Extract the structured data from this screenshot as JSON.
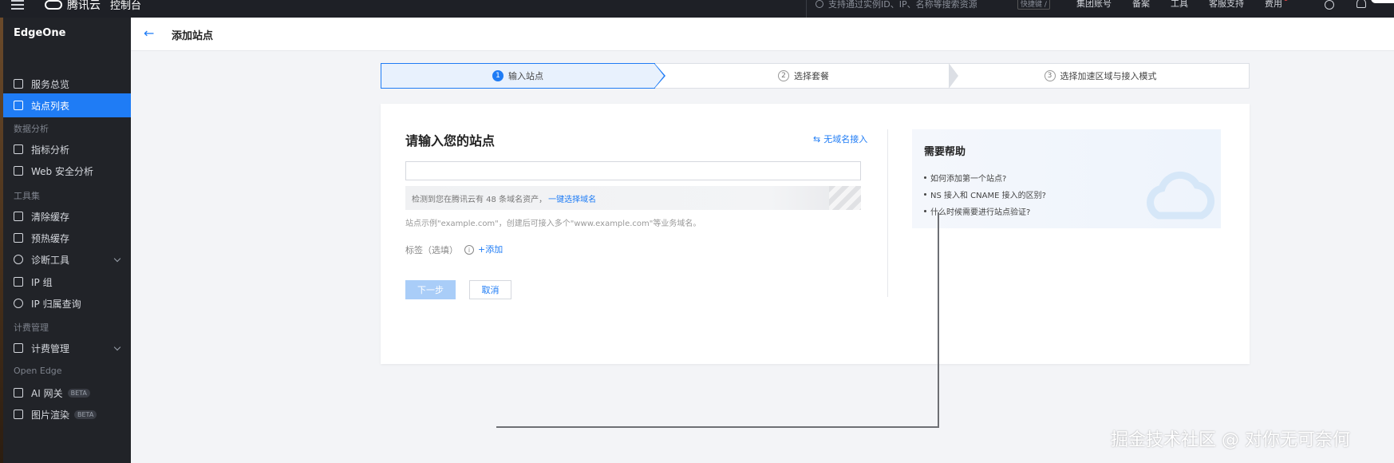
{
  "topbar": {
    "brand": "腾讯云",
    "console": "控制台",
    "search_placeholder": "支持通过实例ID、IP、名称等搜索资源",
    "shortcut": "快捷键 /",
    "links": [
      "集团账号",
      "备案",
      "工具",
      "客服支持",
      "费用"
    ],
    "extra_link": "费用"
  },
  "sidebar": {
    "product": "EdgeOne",
    "items": [
      {
        "label": "服务总览",
        "icon": "grid-icon"
      },
      {
        "label": "站点列表",
        "icon": "list-icon"
      }
    ],
    "group_data": "数据分析",
    "data_items": [
      {
        "label": "指标分析",
        "icon": "chart-icon"
      },
      {
        "label": "Web 安全分析",
        "icon": "shield-icon"
      }
    ],
    "group_tools": "工具集",
    "tool_items": [
      {
        "label": "清除缓存",
        "icon": "refresh-icon"
      },
      {
        "label": "预热缓存",
        "icon": "download-icon"
      },
      {
        "label": "诊断工具",
        "icon": "diagnose-icon"
      },
      {
        "label": "IP 组",
        "icon": "ip-icon"
      },
      {
        "label": "IP 归属查询",
        "icon": "search-icon"
      }
    ],
    "group_billing": "计费管理",
    "billing_items": [
      {
        "label": "计费管理",
        "icon": "billing-icon"
      }
    ],
    "group_edge": "Open Edge",
    "edge_items": [
      {
        "label": "AI 网关",
        "badge": "BETA",
        "icon": "ai-icon"
      },
      {
        "label": "图片渲染",
        "badge": "BETA",
        "icon": "image-icon"
      }
    ]
  },
  "header": {
    "title": "添加站点"
  },
  "steps": [
    {
      "num": "1",
      "label": "输入站点"
    },
    {
      "num": "2",
      "label": "选择套餐"
    },
    {
      "num": "3",
      "label": "选择加速区域与接入模式"
    }
  ],
  "form": {
    "title": "请输入您的站点",
    "no_domain_link": "无域名接入",
    "site_input_value": "",
    "notice_text": "检测到您在腾讯云有 48 条域名资产，",
    "notice_link": "一键选择域名",
    "hint": "站点示例\"example.com\"，创建后可接入多个\"www.example.com\"等业务域名。",
    "tag_label": "标签（选填）",
    "add_label": "添加",
    "next_label": "下一步",
    "cancel_label": "取消"
  },
  "help": {
    "title": "需要帮助",
    "items": [
      "如何添加第一个站点?",
      "NS 接入和 CNAME 接入的区别?",
      "什么时候需要进行站点验证?"
    ]
  },
  "watermark": "掘金技术社区 @ 对你无可奈何",
  "colors": {
    "accent": "#1f7cf5",
    "sidebar_bg": "#212328",
    "topbar_bg": "#1e2026"
  }
}
